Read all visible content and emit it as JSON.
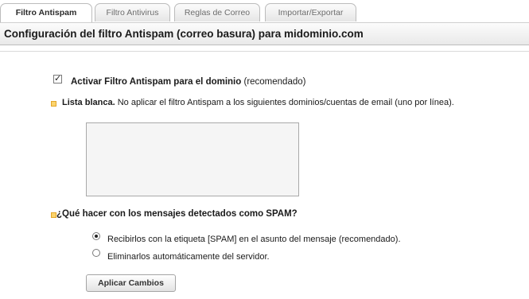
{
  "tabs": [
    {
      "label": "Filtro Antispam",
      "active": true
    },
    {
      "label": "Filtro Antivirus",
      "active": false
    },
    {
      "label": "Reglas de Correo",
      "active": false
    },
    {
      "label": "Importar/Exportar",
      "active": false
    }
  ],
  "header": {
    "title": "Configuración del filtro Antispam (correo basura) para midominio.com"
  },
  "activate": {
    "checked": true,
    "label_bold": "Activar Filtro Antispam para el dominio",
    "label_note": "(recomendado)"
  },
  "whitelist": {
    "title": "Lista blanca.",
    "description": "No aplicar el filtro Antispam a los siguientes dominios/cuentas de email (uno por línea).",
    "value": ""
  },
  "spam_action": {
    "question": "¿Qué hacer con los mensajes detectados como SPAM?",
    "options": [
      {
        "label": "Recibirlos con la etiqueta [SPAM] en el asunto del mensaje (recomendado).",
        "selected": true
      },
      {
        "label": "Eliminarlos automáticamente del servidor.",
        "selected": false
      }
    ]
  },
  "apply_button": "Aplicar Cambios",
  "colors": {
    "bullet": "#fbd46c",
    "header_bg": "#e9e9e9"
  }
}
